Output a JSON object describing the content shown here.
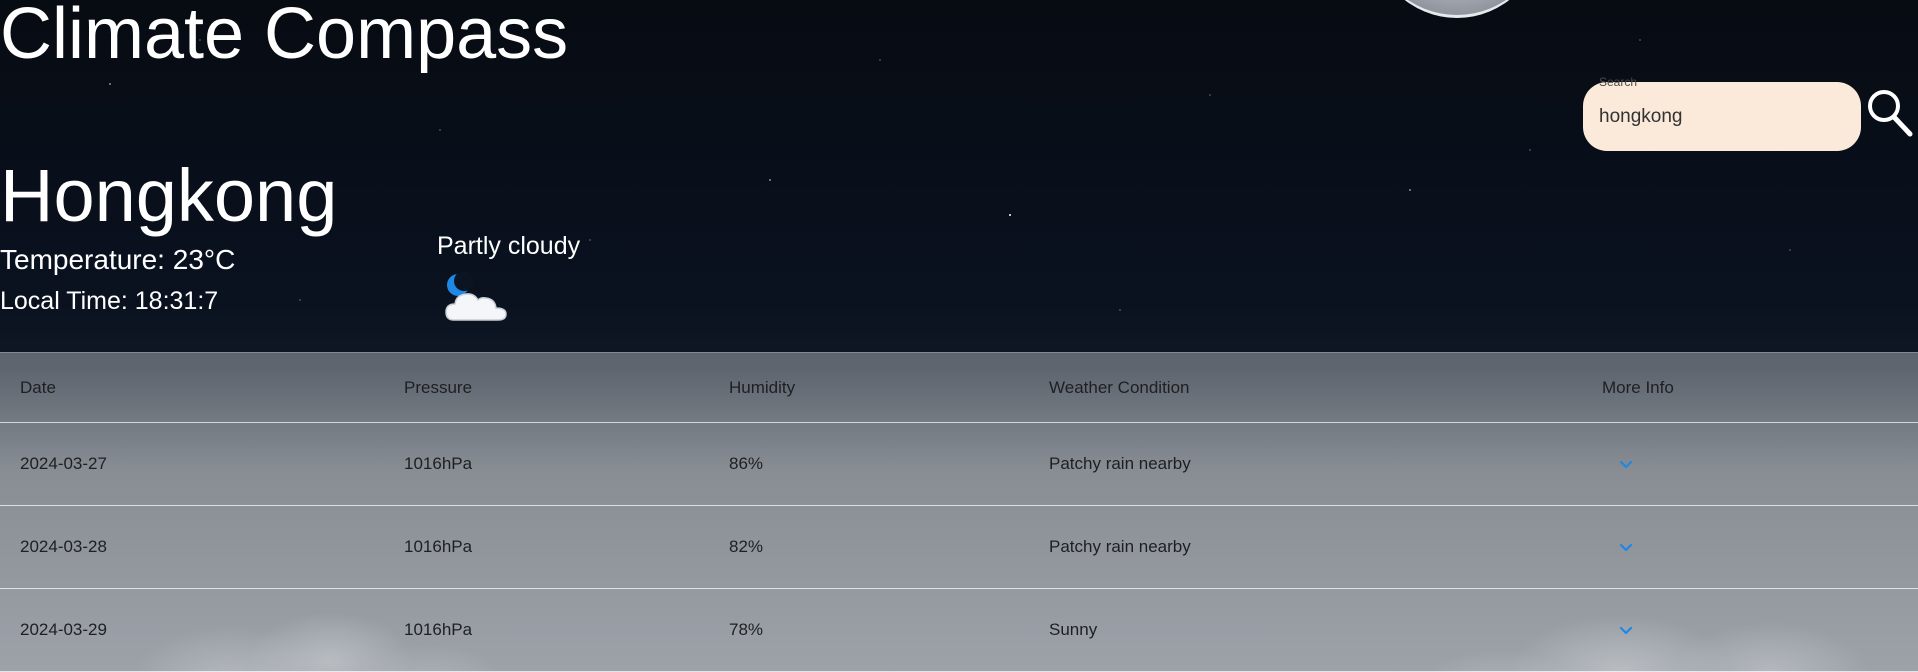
{
  "app": {
    "title": "Climate Compass"
  },
  "search": {
    "label": "Search",
    "value": "hongkong",
    "icon": "search-icon"
  },
  "current": {
    "city": "Hongkong",
    "temperature": "Temperature: 23°C",
    "local_time": "Local Time: 18:31:7",
    "condition": "Partly cloudy",
    "condition_icon": "partly-cloudy-night-icon"
  },
  "table": {
    "headers": [
      "Date",
      "Pressure",
      "Humidity",
      "Weather Condition",
      "More Info"
    ],
    "rows": [
      {
        "date": "2024-03-27",
        "pressure": "1016hPa",
        "humidity": "86%",
        "condition": "Patchy rain nearby"
      },
      {
        "date": "2024-03-28",
        "pressure": "1016hPa",
        "humidity": "82%",
        "condition": "Patchy rain nearby"
      },
      {
        "date": "2024-03-29",
        "pressure": "1016hPa",
        "humidity": "78%",
        "condition": "Sunny"
      }
    ],
    "expand_icon": "chevron-down-icon"
  },
  "colors": {
    "accent": "#1e88e5",
    "search_bg": "#fbeada",
    "text_light": "#ffffff"
  }
}
